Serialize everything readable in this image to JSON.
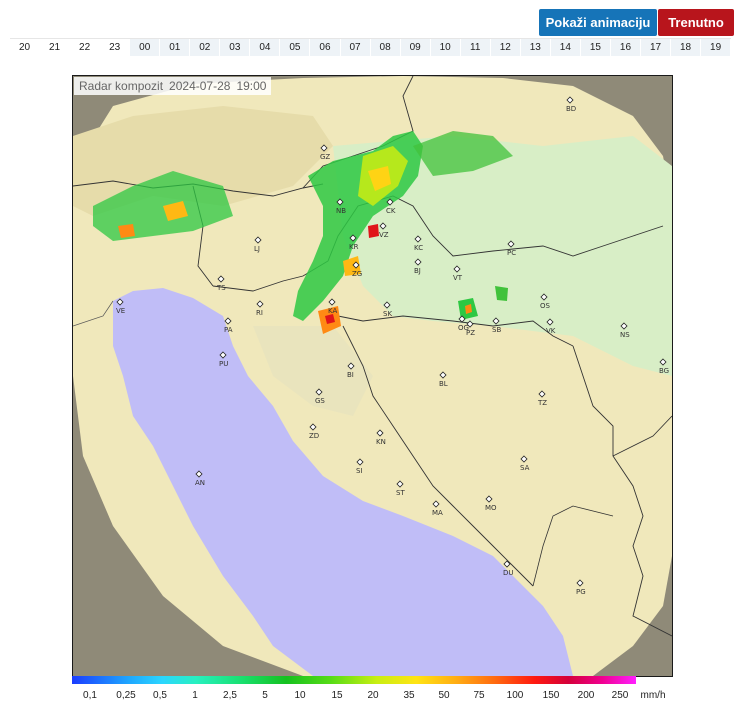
{
  "controls": {
    "animate_label": "Pokaži animaciju",
    "current_label": "Trenutno"
  },
  "hours": [
    "20",
    "21",
    "22",
    "23",
    "00",
    "01",
    "02",
    "03",
    "04",
    "05",
    "06",
    "07",
    "08",
    "09",
    "10",
    "11",
    "12",
    "13",
    "14",
    "15",
    "16",
    "17",
    "18",
    "19"
  ],
  "map": {
    "title": "Radar kompozit",
    "date": "2024-07-28",
    "time": "19:00",
    "stations": [
      {
        "code": "BD"
      },
      {
        "code": "GZ"
      },
      {
        "code": "NB"
      },
      {
        "code": "CK"
      },
      {
        "code": "VZ"
      },
      {
        "code": "KR"
      },
      {
        "code": "KC"
      },
      {
        "code": "PC"
      },
      {
        "code": "LJ"
      },
      {
        "code": "ZG"
      },
      {
        "code": "BJ"
      },
      {
        "code": "VT"
      },
      {
        "code": "TS"
      },
      {
        "code": "OS"
      },
      {
        "code": "VE"
      },
      {
        "code": "RI"
      },
      {
        "code": "SK"
      },
      {
        "code": "KA"
      },
      {
        "code": "PA"
      },
      {
        "code": "OG"
      },
      {
        "code": "SB"
      },
      {
        "code": "VK"
      },
      {
        "code": "NS"
      },
      {
        "code": "PU"
      },
      {
        "code": "PZ"
      },
      {
        "code": "BI"
      },
      {
        "code": "BG"
      },
      {
        "code": "BL"
      },
      {
        "code": "GS"
      },
      {
        "code": "TZ"
      },
      {
        "code": "ZD"
      },
      {
        "code": "KN"
      },
      {
        "code": "SI"
      },
      {
        "code": "SA"
      },
      {
        "code": "AN"
      },
      {
        "code": "ST"
      },
      {
        "code": "MO"
      },
      {
        "code": "MA"
      },
      {
        "code": "DU"
      },
      {
        "code": "PG"
      }
    ]
  },
  "legend": {
    "unit": "mm/h",
    "values": [
      "0,1",
      "0,25",
      "0,5",
      "1",
      "2,5",
      "5",
      "10",
      "15",
      "20",
      "35",
      "50",
      "75",
      "100",
      "150",
      "200",
      "250"
    ]
  },
  "colors": {
    "button_blue": "#1674b8",
    "button_red": "#b8151c",
    "sea": "#c0bdf7",
    "land_in_range": "#f0e9bd",
    "lowland": "#d7eec4",
    "out_of_range": "#8f8a78"
  }
}
